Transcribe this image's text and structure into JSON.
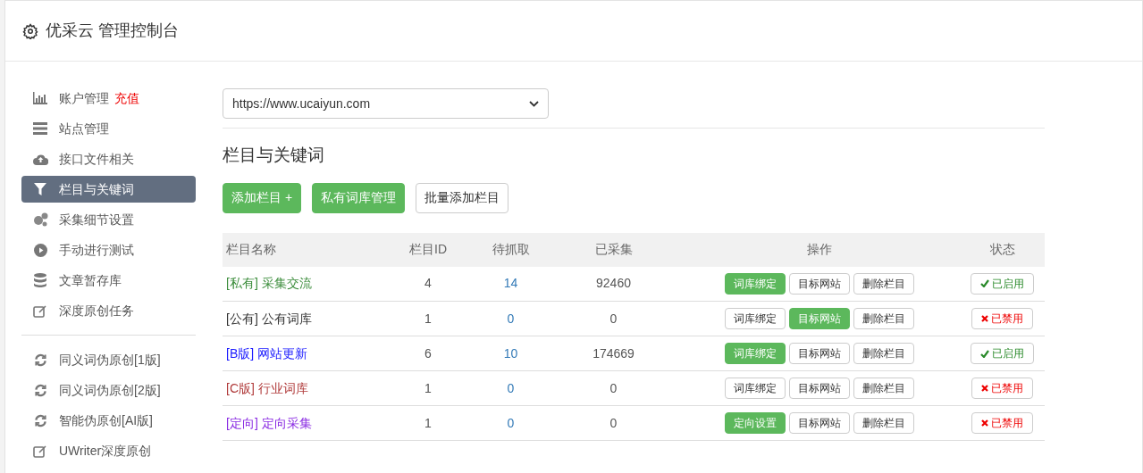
{
  "header": {
    "title": "优采云 管理控制台"
  },
  "sidebar": {
    "groups": [
      {
        "items": [
          {
            "label": "账户管理",
            "badge": "充值",
            "selected": false
          },
          {
            "label": "站点管理",
            "selected": false
          },
          {
            "label": "接口文件相关",
            "selected": false
          },
          {
            "label": "栏目与关键词",
            "selected": true
          },
          {
            "label": "采集细节设置",
            "selected": false
          },
          {
            "label": "手动进行测试",
            "selected": false
          },
          {
            "label": "文章暂存库",
            "selected": false
          },
          {
            "label": "深度原创任务",
            "selected": false
          }
        ]
      },
      {
        "items": [
          {
            "label": "同义词伪原创[1版]",
            "selected": false
          },
          {
            "label": "同义词伪原创[2版]",
            "selected": false
          },
          {
            "label": "智能伪原创[AI版]",
            "selected": false
          },
          {
            "label": "UWriter深度原创",
            "selected": false
          }
        ]
      }
    ]
  },
  "site_select": {
    "value": "https://www.ucaiyun.com"
  },
  "section_title": "栏目与关键词",
  "toolbar": [
    {
      "label": "添加栏目 +",
      "kind": "primary"
    },
    {
      "label": "私有词库管理",
      "kind": "primary"
    },
    {
      "label": "批量添加栏目",
      "kind": "default"
    }
  ],
  "table": {
    "columns": [
      "栏目名称",
      "栏目ID",
      "待抓取",
      "已采集",
      "操作",
      "状态"
    ],
    "rows": [
      {
        "tag": "[私有]",
        "name": "采集交流",
        "color": "#3c8d3c",
        "id": "4",
        "pending": "14",
        "collected": "92460",
        "actions": [
          {
            "label": "词库绑定",
            "primary": true
          },
          {
            "label": "目标网站",
            "primary": false
          },
          {
            "label": "删除栏目",
            "primary": false
          }
        ],
        "enabled": true,
        "status": "已启用"
      },
      {
        "tag": "[公有]",
        "name": "公有词库",
        "color": "#333333",
        "id": "1",
        "pending": "0",
        "collected": "0",
        "actions": [
          {
            "label": "词库绑定",
            "primary": false
          },
          {
            "label": "目标网站",
            "primary": true
          },
          {
            "label": "删除栏目",
            "primary": false
          }
        ],
        "enabled": false,
        "status": "已禁用"
      },
      {
        "tag": "[B版]",
        "name": "网站更新",
        "color": "#1a1aff",
        "id": "6",
        "pending": "10",
        "collected": "174669",
        "actions": [
          {
            "label": "词库绑定",
            "primary": true
          },
          {
            "label": "目标网站",
            "primary": false
          },
          {
            "label": "删除栏目",
            "primary": false
          }
        ],
        "enabled": true,
        "status": "已启用"
      },
      {
        "tag": "[C版]",
        "name": "行业词库",
        "color": "#b03a3a",
        "id": "1",
        "pending": "0",
        "collected": "0",
        "actions": [
          {
            "label": "词库绑定",
            "primary": false
          },
          {
            "label": "目标网站",
            "primary": false
          },
          {
            "label": "删除栏目",
            "primary": false
          }
        ],
        "enabled": false,
        "status": "已禁用"
      },
      {
        "tag": "[定向]",
        "name": "定向采集",
        "color": "#8a2be2",
        "id": "1",
        "pending": "0",
        "collected": "0",
        "actions": [
          {
            "label": "定向设置",
            "primary": true
          },
          {
            "label": "目标网站",
            "primary": false
          },
          {
            "label": "删除栏目",
            "primary": false
          }
        ],
        "enabled": false,
        "status": "已禁用"
      }
    ]
  }
}
